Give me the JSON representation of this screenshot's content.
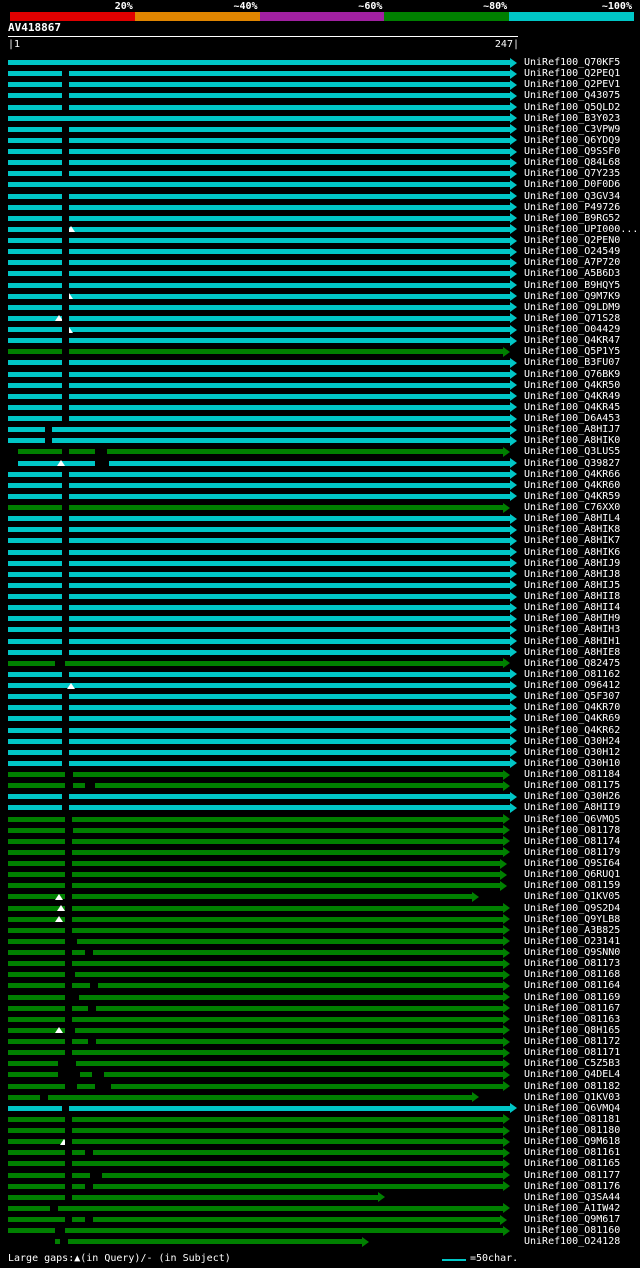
{
  "header": {
    "scale_segments": [
      {
        "label": "20%",
        "color": "#e00000"
      },
      {
        "label": "~40%",
        "color": "#e08500"
      },
      {
        "label": "~60%",
        "color": "#a020a0"
      },
      {
        "label": "~80%",
        "color": "#008000"
      },
      {
        "label": "~100%",
        "color": "#00c6c6"
      }
    ],
    "query": {
      "name": "AV418867",
      "start_label": "|1",
      "end_label": "247|",
      "length": 247
    }
  },
  "colors": {
    "cyan": "#00c6c6",
    "green": "#008000",
    "gap_dash": "#000000",
    "gap_tri": "#ffffff"
  },
  "rows": [
    {
      "label": "UniRef100_Q70KF5",
      "m": []
    },
    {
      "label": "UniRef100_Q2PEQ1",
      "m": [
        [
          "dash",
          62
        ]
      ]
    },
    {
      "label": "UniRef100_Q2PEV1",
      "m": [
        [
          "dash",
          62
        ]
      ]
    },
    {
      "label": "UniRef100_Q43075",
      "m": [
        [
          "dash",
          62
        ]
      ]
    },
    {
      "label": "UniRef100_Q5QLD2",
      "m": [
        [
          "dash",
          62
        ]
      ]
    },
    {
      "label": "UniRef100_B3Y023",
      "m": []
    },
    {
      "label": "UniRef100_C3VPW9",
      "m": [
        [
          "dash",
          62
        ]
      ]
    },
    {
      "label": "UniRef100_Q6YDQ9",
      "m": [
        [
          "dash",
          62
        ]
      ]
    },
    {
      "label": "UniRef100_Q9SSF0",
      "m": [
        [
          "dash",
          62
        ]
      ]
    },
    {
      "label": "UniRef100_Q84L68",
      "m": [
        [
          "dash",
          62
        ]
      ]
    },
    {
      "label": "UniRef100_Q7Y235",
      "m": [
        [
          "dash",
          62
        ]
      ]
    },
    {
      "label": "UniRef100_D0F0D6",
      "m": []
    },
    {
      "label": "UniRef100_Q3GV34",
      "m": [
        [
          "dash",
          62
        ]
      ]
    },
    {
      "label": "UniRef100_P49726",
      "m": [
        [
          "dash",
          62
        ]
      ]
    },
    {
      "label": "UniRef100_B9RG52",
      "m": [
        [
          "dash",
          62
        ]
      ]
    },
    {
      "label": "UniRef100_UPI000...",
      "m": [
        [
          "tri",
          67
        ],
        [
          "dash",
          62
        ]
      ]
    },
    {
      "label": "UniRef100_Q2PEN0",
      "m": [
        [
          "dash",
          62
        ]
      ]
    },
    {
      "label": "UniRef100_O24549",
      "m": [
        [
          "dash",
          62
        ]
      ]
    },
    {
      "label": "UniRef100_A7P720",
      "m": [
        [
          "dash",
          62
        ]
      ]
    },
    {
      "label": "UniRef100_A5B6D3",
      "m": [
        [
          "dash",
          62
        ]
      ]
    },
    {
      "label": "UniRef100_B9HQY5",
      "m": [
        [
          "dash",
          62
        ]
      ]
    },
    {
      "label": "UniRef100_Q9M7K9",
      "m": [
        [
          "tri",
          65
        ],
        [
          "dash",
          62
        ]
      ]
    },
    {
      "label": "UniRef100_Q9LDM9",
      "m": [
        [
          "dash",
          62
        ]
      ]
    },
    {
      "label": "UniRef100_Q71S28",
      "m": [
        [
          "tri",
          55
        ],
        [
          "dash",
          62
        ]
      ]
    },
    {
      "label": "UniRef100_O04429",
      "m": [
        [
          "tri",
          65
        ],
        [
          "dash",
          62
        ]
      ]
    },
    {
      "label": "UniRef100_Q4KR47",
      "m": [
        [
          "dash",
          62
        ]
      ]
    },
    {
      "label": "UniRef100_Q5P1Y5",
      "c": "green",
      "m": [
        [
          "dash",
          62
        ]
      ]
    },
    {
      "label": "UniRef100_B3FU07",
      "m": [
        [
          "dash",
          62
        ]
      ]
    },
    {
      "label": "UniRef100_Q76BK9",
      "m": [
        [
          "dash",
          62
        ]
      ]
    },
    {
      "label": "UniRef100_Q4KR50",
      "m": [
        [
          "dash",
          62
        ]
      ]
    },
    {
      "label": "UniRef100_Q4KR49",
      "m": [
        [
          "dash",
          62
        ]
      ]
    },
    {
      "label": "UniRef100_Q4KR45",
      "m": [
        [
          "dash",
          62
        ]
      ]
    },
    {
      "label": "UniRef100_D6A453",
      "m": [
        [
          "dash",
          62
        ]
      ]
    },
    {
      "label": "UniRef100_A8HIJ7",
      "m": [
        [
          "dash",
          45
        ]
      ]
    },
    {
      "label": "UniRef100_A8HIK0",
      "m": [
        [
          "dash",
          45
        ]
      ]
    },
    {
      "label": "UniRef100_Q3LUS5",
      "c": "green",
      "s": 18,
      "m": [
        [
          "dash",
          62
        ],
        [
          "dash",
          95,
          12
        ]
      ]
    },
    {
      "label": "UniRef100_Q39827",
      "s": 18,
      "m": [
        [
          "tri",
          57
        ],
        [
          "dash",
          95,
          14
        ]
      ]
    },
    {
      "label": "UniRef100_Q4KR66",
      "m": [
        [
          "dash",
          62
        ]
      ]
    },
    {
      "label": "UniRef100_Q4KR60",
      "m": [
        [
          "dash",
          62
        ]
      ]
    },
    {
      "label": "UniRef100_Q4KR59",
      "m": [
        [
          "dash",
          62
        ]
      ]
    },
    {
      "label": "UniRef100_C76XX0",
      "c": "green",
      "m": [
        [
          "dash",
          62
        ]
      ]
    },
    {
      "label": "UniRef100_A8HIL4",
      "m": [
        [
          "dash",
          62
        ]
      ]
    },
    {
      "label": "UniRef100_A8HIK8",
      "m": [
        [
          "dash",
          62
        ]
      ]
    },
    {
      "label": "UniRef100_A8HIK7",
      "m": [
        [
          "dash",
          62
        ]
      ]
    },
    {
      "label": "UniRef100_A8HIK6",
      "m": [
        [
          "dash",
          62
        ]
      ]
    },
    {
      "label": "UniRef100_A8HIJ9",
      "m": [
        [
          "dash",
          62
        ]
      ]
    },
    {
      "label": "UniRef100_A8HIJ8",
      "m": [
        [
          "dash",
          62
        ]
      ]
    },
    {
      "label": "UniRef100_A8HIJ5",
      "m": [
        [
          "dash",
          62
        ]
      ]
    },
    {
      "label": "UniRef100_A8HII8",
      "m": [
        [
          "dash",
          62
        ]
      ]
    },
    {
      "label": "UniRef100_A8HII4",
      "m": [
        [
          "dash",
          62
        ]
      ]
    },
    {
      "label": "UniRef100_A8HIH9",
      "m": [
        [
          "dash",
          62
        ]
      ]
    },
    {
      "label": "UniRef100_A8HIH3",
      "m": [
        [
          "dash",
          62
        ]
      ]
    },
    {
      "label": "UniRef100_A8HIH1",
      "m": [
        [
          "dash",
          62
        ]
      ]
    },
    {
      "label": "UniRef100_A8HIE8",
      "m": [
        [
          "dash",
          62
        ]
      ]
    },
    {
      "label": "UniRef100_Q82475",
      "c": "green",
      "m": [
        [
          "dash",
          55,
          10
        ]
      ]
    },
    {
      "label": "UniRef100_O81162",
      "m": [
        [
          "dash",
          62
        ]
      ]
    },
    {
      "label": "UniRef100_O96412",
      "m": [
        [
          "tri",
          67
        ]
      ]
    },
    {
      "label": "UniRef100_Q5F307",
      "m": [
        [
          "dash",
          62
        ]
      ]
    },
    {
      "label": "UniRef100_Q4KR70",
      "m": [
        [
          "dash",
          62
        ]
      ]
    },
    {
      "label": "UniRef100_Q4KR69",
      "m": [
        [
          "dash",
          62
        ]
      ]
    },
    {
      "label": "UniRef100_Q4KR62",
      "m": [
        [
          "dash",
          62
        ]
      ]
    },
    {
      "label": "UniRef100_Q30H24",
      "m": [
        [
          "dash",
          62
        ]
      ]
    },
    {
      "label": "UniRef100_Q30H12",
      "m": [
        [
          "dash",
          62
        ]
      ]
    },
    {
      "label": "UniRef100_Q30H10",
      "m": [
        [
          "dash",
          62
        ]
      ]
    },
    {
      "label": "UniRef100_O81184",
      "c": "green",
      "m": [
        [
          "dash",
          65,
          8
        ]
      ]
    },
    {
      "label": "UniRef100_O81175",
      "c": "green",
      "m": [
        [
          "dash",
          65,
          8
        ],
        [
          "dash",
          85,
          10
        ]
      ]
    },
    {
      "label": "UniRef100_Q30H26",
      "m": [
        [
          "dash",
          62
        ]
      ]
    },
    {
      "label": "UniRef100_A8HII9",
      "m": [
        [
          "dash",
          62
        ]
      ]
    },
    {
      "label": "UniRef100_Q6VMQ5",
      "c": "green",
      "m": [
        [
          "dash",
          65
        ]
      ]
    },
    {
      "label": "UniRef100_O81178",
      "c": "green",
      "m": [
        [
          "dash",
          65,
          8
        ]
      ]
    },
    {
      "label": "UniRef100_O81174",
      "c": "green",
      "m": [
        [
          "dash",
          65
        ]
      ]
    },
    {
      "label": "UniRef100_O81179",
      "c": "green",
      "m": [
        [
          "dash",
          65
        ]
      ]
    },
    {
      "label": "UniRef100_Q9SI64",
      "c": "green",
      "e": 500,
      "m": [
        [
          "dash",
          65
        ]
      ]
    },
    {
      "label": "UniRef100_Q6RUQ1",
      "c": "green",
      "e": 500,
      "m": [
        [
          "dash",
          65
        ]
      ]
    },
    {
      "label": "UniRef100_O81159",
      "c": "green",
      "e": 500,
      "m": [
        [
          "dash",
          65
        ]
      ]
    },
    {
      "label": "UniRef100_Q1KV05",
      "c": "green",
      "e": 472,
      "m": [
        [
          "tri",
          55
        ],
        [
          "dash",
          65
        ]
      ]
    },
    {
      "label": "UniRef100_Q9S2D4",
      "c": "green",
      "m": [
        [
          "tri",
          57
        ],
        [
          "dash",
          65
        ]
      ]
    },
    {
      "label": "UniRef100_Q9YLB8",
      "c": "green",
      "m": [
        [
          "tri",
          55
        ],
        [
          "dash",
          65
        ]
      ]
    },
    {
      "label": "UniRef100_A3B825",
      "c": "green",
      "m": [
        [
          "dash",
          65
        ]
      ]
    },
    {
      "label": "UniRef100_O23141",
      "c": "green",
      "m": [
        [
          "dash",
          65,
          12
        ]
      ]
    },
    {
      "label": "UniRef100_Q9SNN0",
      "c": "green",
      "m": [
        [
          "dash",
          65
        ],
        [
          "dash",
          85,
          8
        ]
      ]
    },
    {
      "label": "UniRef100_O81173",
      "c": "green",
      "m": [
        [
          "dash",
          65
        ]
      ]
    },
    {
      "label": "UniRef100_O81168",
      "c": "green",
      "m": [
        [
          "dash",
          65,
          10
        ]
      ]
    },
    {
      "label": "UniRef100_O81164",
      "c": "green",
      "m": [
        [
          "dash",
          65
        ],
        [
          "dash",
          90,
          8
        ]
      ]
    },
    {
      "label": "UniRef100_O81169",
      "c": "green",
      "m": [
        [
          "dash",
          65,
          14
        ]
      ]
    },
    {
      "label": "UniRef100_O81167",
      "c": "green",
      "m": [
        [
          "dash",
          65
        ],
        [
          "dash",
          88,
          8
        ]
      ]
    },
    {
      "label": "UniRef100_O81163",
      "c": "green",
      "m": [
        [
          "dash",
          65
        ]
      ]
    },
    {
      "label": "UniRef100_Q8H165",
      "c": "green",
      "m": [
        [
          "tri",
          55
        ],
        [
          "dash",
          65,
          10
        ]
      ]
    },
    {
      "label": "UniRef100_O81172",
      "c": "green",
      "m": [
        [
          "dash",
          65
        ],
        [
          "dash",
          88,
          8
        ]
      ]
    },
    {
      "label": "UniRef100_O81171",
      "c": "green",
      "m": [
        [
          "dash",
          65
        ]
      ]
    },
    {
      "label": "UniRef100_C5Z5B3",
      "c": "green",
      "m": [
        [
          "dash",
          58,
          18
        ]
      ]
    },
    {
      "label": "UniRef100_Q4DEL4",
      "c": "green",
      "m": [
        [
          "dash",
          58,
          22
        ],
        [
          "dash",
          92,
          12
        ]
      ]
    },
    {
      "label": "UniRef100_O81182",
      "c": "green",
      "m": [
        [
          "dash",
          65,
          12
        ],
        [
          "dash",
          95,
          16
        ]
      ]
    },
    {
      "label": "UniRef100_Q1KV03",
      "c": "green",
      "e": 472,
      "m": [
        [
          "dash",
          40,
          8
        ]
      ]
    },
    {
      "label": "UniRef100_Q6VMQ4",
      "m": [
        [
          "dash",
          62
        ]
      ]
    },
    {
      "label": "UniRef100_O81181",
      "c": "green",
      "m": [
        [
          "dash",
          65
        ]
      ]
    },
    {
      "label": "UniRef100_O81180",
      "c": "green",
      "m": [
        [
          "dash",
          65
        ]
      ]
    },
    {
      "label": "UniRef100_Q9M618",
      "c": "green",
      "m": [
        [
          "tri",
          60
        ],
        [
          "dash",
          65
        ]
      ]
    },
    {
      "label": "UniRef100_O81161",
      "c": "green",
      "m": [
        [
          "dash",
          65
        ],
        [
          "dash",
          85,
          8
        ]
      ]
    },
    {
      "label": "UniRef100_O81165",
      "c": "green",
      "m": [
        [
          "dash",
          65
        ]
      ]
    },
    {
      "label": "UniRef100_O81177",
      "c": "green",
      "m": [
        [
          "dash",
          65
        ],
        [
          "dash",
          90,
          12
        ]
      ]
    },
    {
      "label": "UniRef100_O81176",
      "c": "green",
      "m": [
        [
          "dash",
          65
        ],
        [
          "dash",
          85,
          8
        ]
      ]
    },
    {
      "label": "UniRef100_Q3SA44",
      "c": "green",
      "e": 378,
      "m": [
        [
          "dash",
          65
        ]
      ]
    },
    {
      "label": "UniRef100_A1IW42",
      "c": "green",
      "m": [
        [
          "dash",
          50,
          8
        ]
      ]
    },
    {
      "label": "UniRef100_Q9M617",
      "c": "green",
      "e": 500,
      "m": [
        [
          "dash",
          65
        ],
        [
          "dash",
          85,
          8
        ]
      ]
    },
    {
      "label": "UniRef100_O81160",
      "c": "green",
      "m": [
        [
          "dash",
          55,
          10
        ]
      ]
    },
    {
      "label": "UniRef100_O24128",
      "c": "green",
      "s": 55,
      "e": 362,
      "m": [
        [
          "dash",
          60,
          8
        ]
      ]
    }
  ],
  "footer": {
    "gaps_legend": "Large gaps:▲(in Query)/- (in Subject)",
    "scale_legend": "=50char."
  }
}
